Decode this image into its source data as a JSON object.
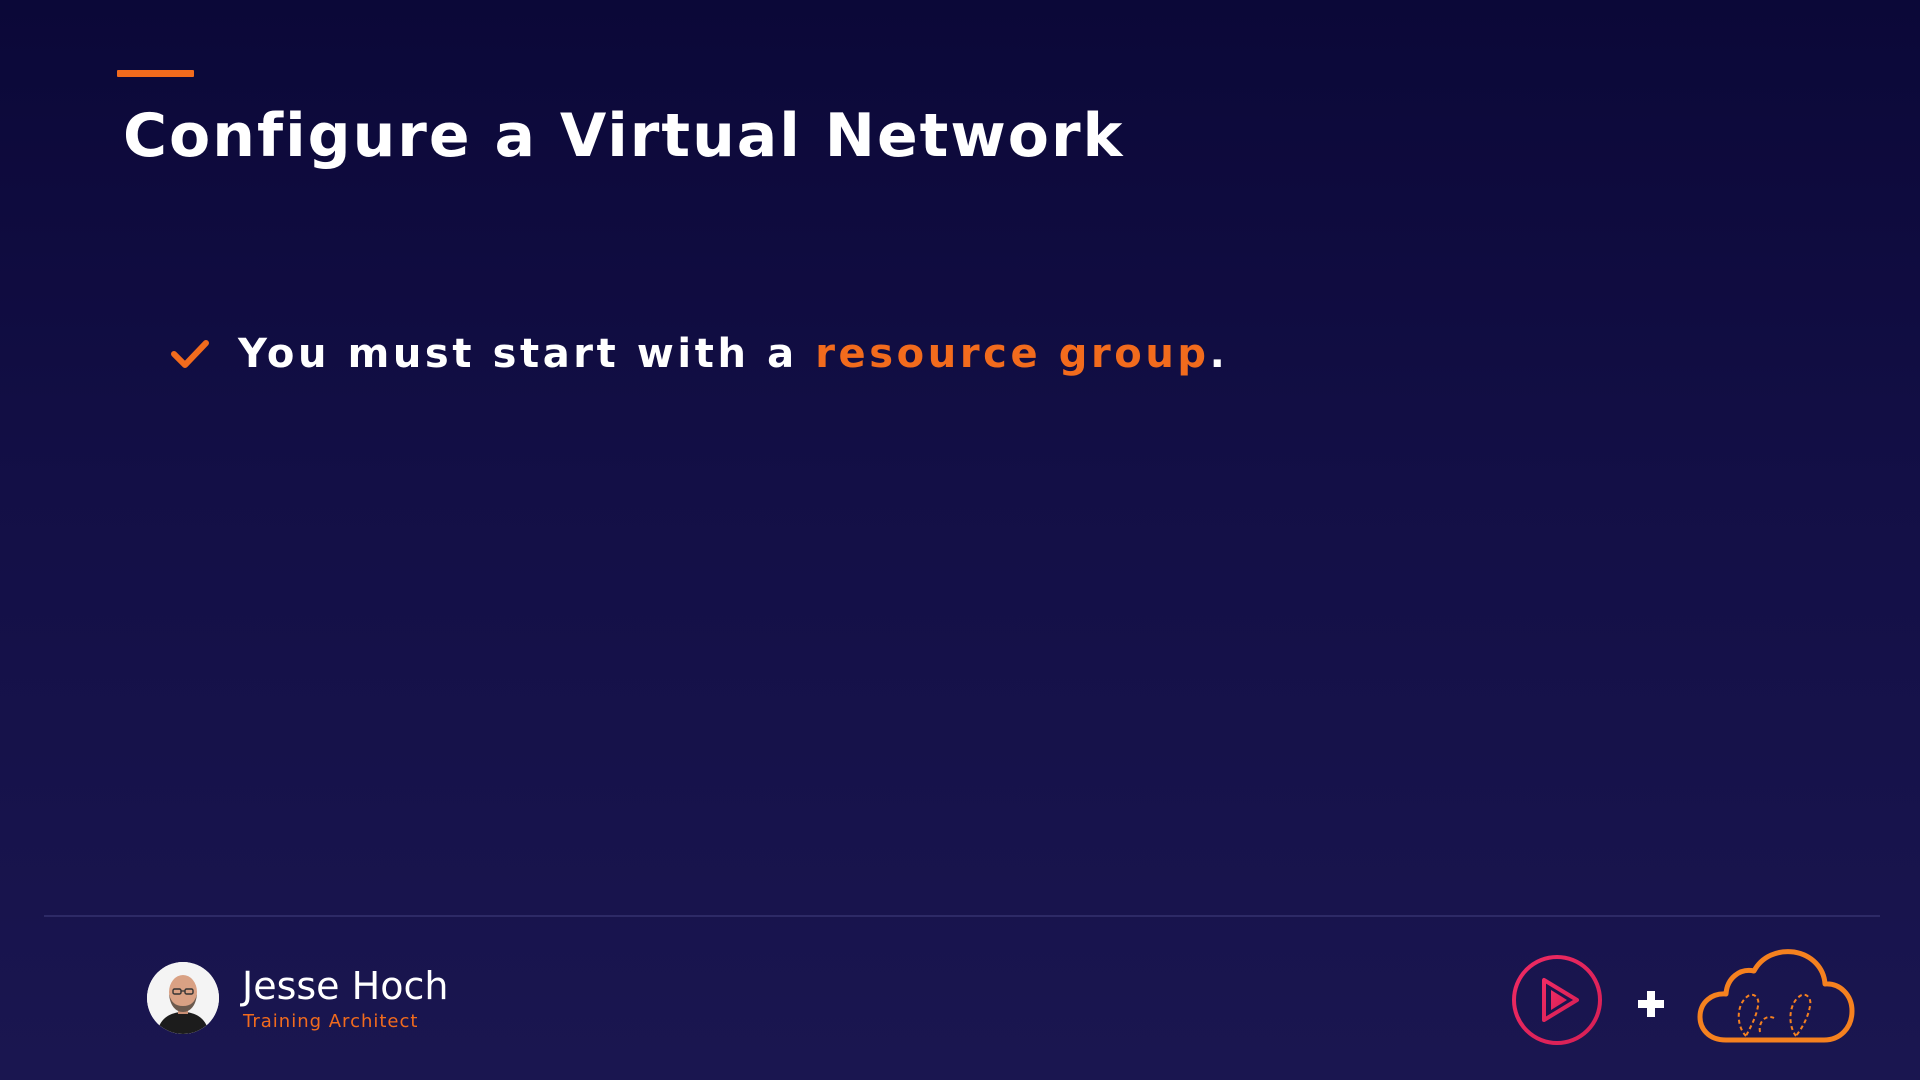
{
  "slide": {
    "title": "Configure a Virtual Network",
    "bullets": [
      {
        "text_before": "You must start with a ",
        "highlight": "resource group",
        "text_after": "."
      }
    ]
  },
  "presenter": {
    "name": "Jesse Hoch",
    "role": "Training Architect"
  },
  "icons": {
    "bullet": "checkmark-icon",
    "left_logo": "play-circle-logo-icon",
    "joiner": "plus-icon",
    "right_logo": "cloud-logo-icon"
  },
  "colors": {
    "background": "#0b0838",
    "accent": "#f26b1d",
    "logo_pink": "#e8255a",
    "text": "#ffffff"
  }
}
